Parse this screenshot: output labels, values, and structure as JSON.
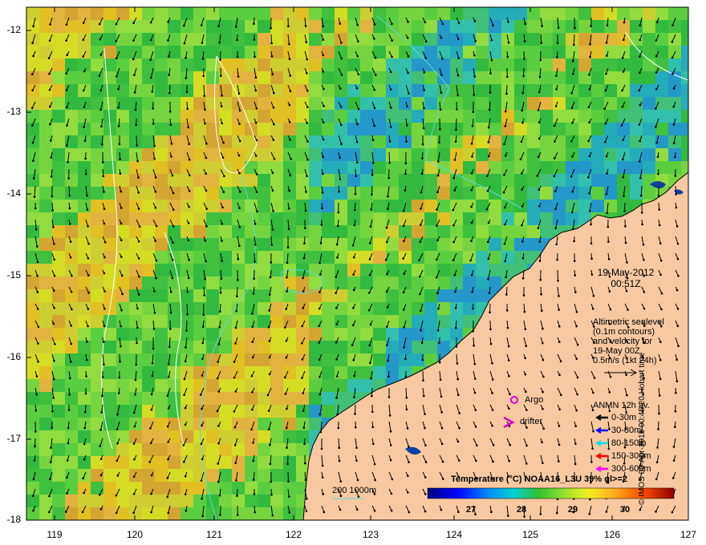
{
  "map": {
    "y_ticks": [
      "-12",
      "-13",
      "-14",
      "-15",
      "-16",
      "-17",
      "-18"
    ],
    "x_ticks": [
      "119",
      "120",
      "121",
      "122",
      "123",
      "124",
      "125",
      "126",
      "127"
    ],
    "date": "19-May-2012",
    "time": "00:51Z",
    "altimetry_note": [
      "Altimetric sealevel",
      "(0.1m contours)",
      "and velocity for",
      "19-May 00Z",
      "0.5m/s (1kt 24h)"
    ],
    "argo_label": "Argo",
    "drifter_label": "drifter",
    "legend_title": "ANMN 12h av.",
    "legend_items": [
      {
        "label": "0-30m",
        "color": "#000000"
      },
      {
        "label": "30-80m",
        "color": "#0000ff"
      },
      {
        "label": "80-150m",
        "color": "#00e0e0"
      },
      {
        "label": "150-300m",
        "color": "#ff0000"
      },
      {
        "label": "300-600m",
        "color": "#ff00ff"
      }
    ],
    "scale_label": "200  1000m",
    "colorbar_title": "Temperature (°C) NOAA16_L3U 39% ql>=2",
    "colorbar_ticks": [
      "27",
      "28",
      "29",
      "30"
    ],
    "watermark": "© IMOS 08-Apr-2015 00:45:20 Hobart time",
    "colors": {
      "land": "#f8c8a0",
      "contour": "#ffffff",
      "isobath": "#5fd8d8",
      "argo": "#d000d0"
    }
  }
}
